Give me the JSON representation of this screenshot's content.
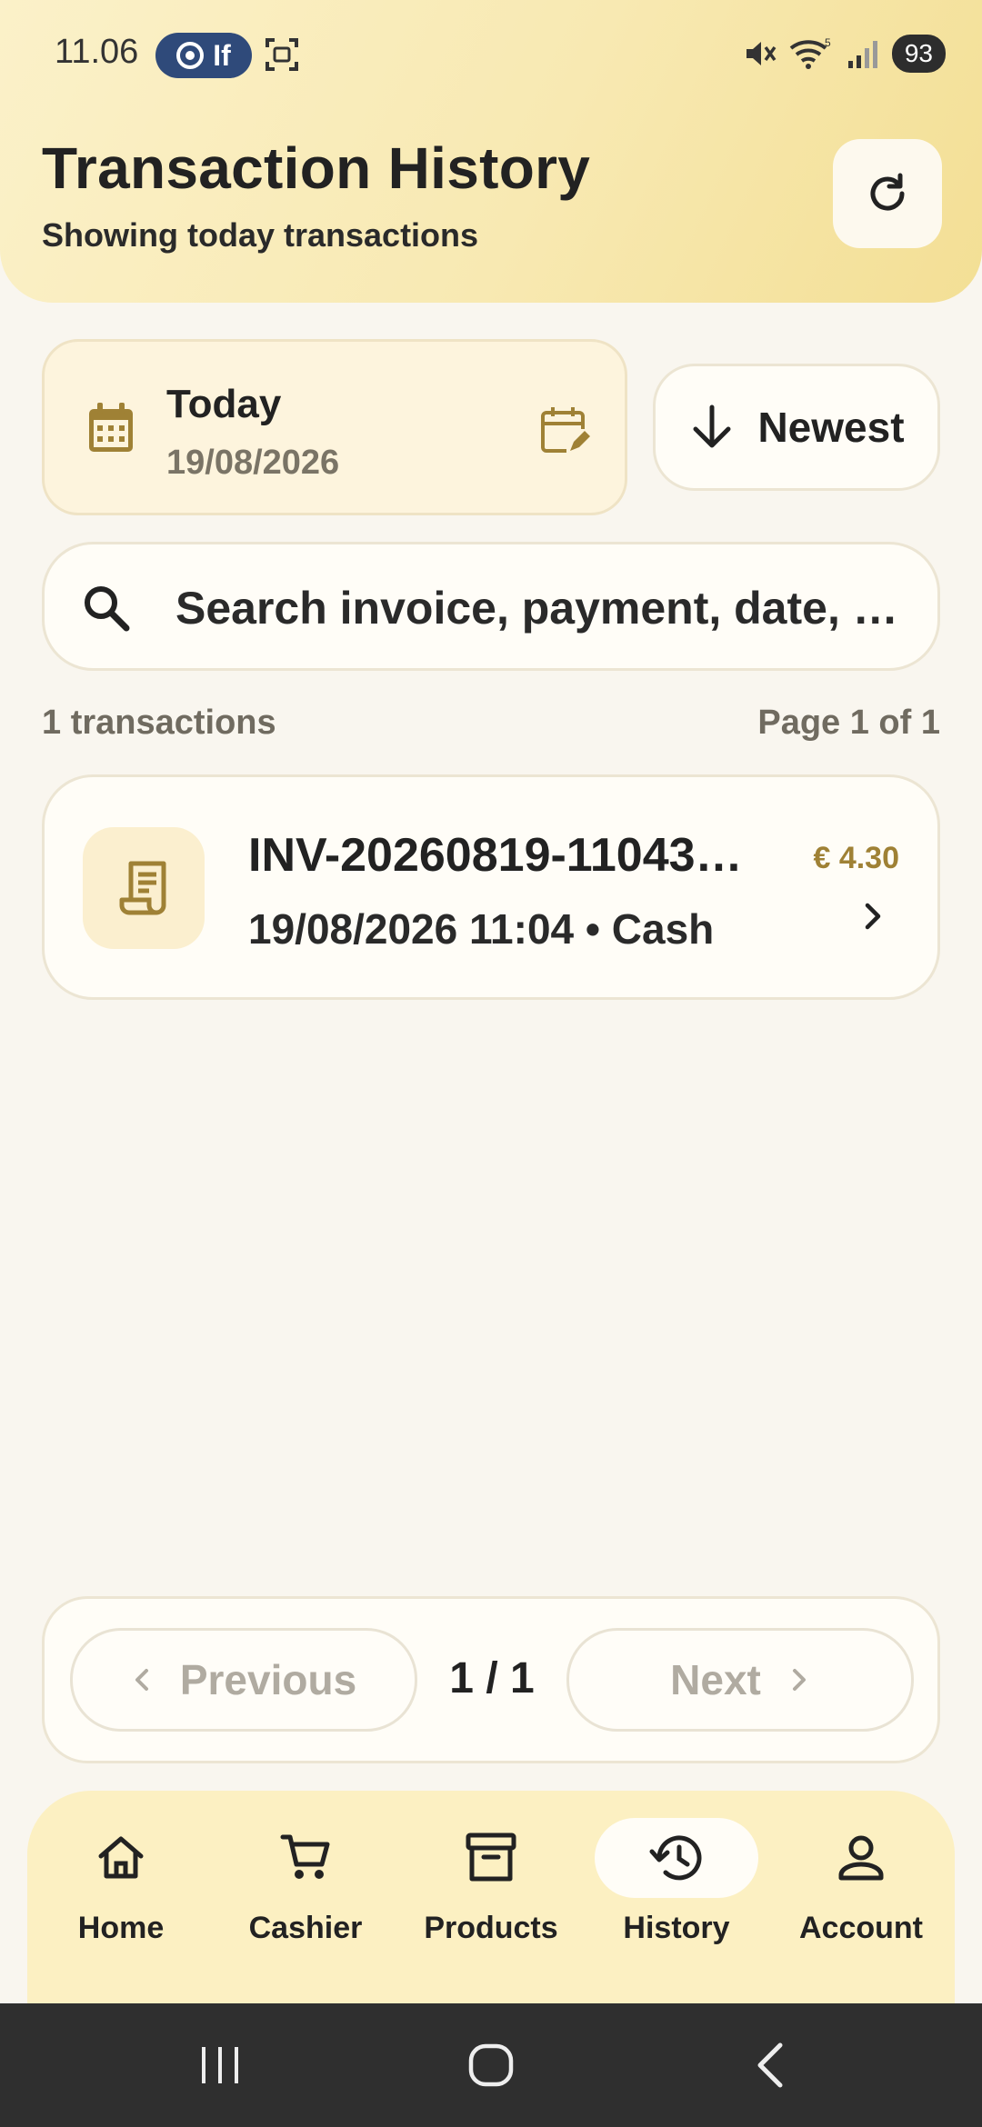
{
  "status_bar": {
    "time": "11.06",
    "pill_text": "If",
    "battery": "93",
    "wifi_badge": "5"
  },
  "header": {
    "title": "Transaction History",
    "subtitle": "Showing today transactions",
    "refresh_icon": "refresh-icon"
  },
  "date_filter": {
    "label": "Today",
    "value": "19/08/2026",
    "icon": "calendar-icon",
    "edit_icon": "calendar-edit-icon"
  },
  "sort": {
    "label": "Newest",
    "icon": "arrow-down-icon"
  },
  "search": {
    "placeholder": "Search invoice, payment, date, …",
    "value": ""
  },
  "results": {
    "count_text": "1 transactions",
    "page_text": "Page 1 of 1"
  },
  "transactions": [
    {
      "invoice": "INV-20260819-11043…",
      "meta": "19/08/2026 11:04 • Cash",
      "amount": "€ 4.30",
      "icon": "receipt-icon"
    }
  ],
  "pagination": {
    "previous_label": "Previous",
    "next_label": "Next",
    "page_indicator": "1 / 1"
  },
  "nav": {
    "items": [
      {
        "label": "Home",
        "icon": "home-icon",
        "active": false
      },
      {
        "label": "Cashier",
        "icon": "cart-icon",
        "active": false
      },
      {
        "label": "Products",
        "icon": "archive-box-icon",
        "active": false
      },
      {
        "label": "History",
        "icon": "history-icon",
        "active": true
      },
      {
        "label": "Account",
        "icon": "person-icon",
        "active": false
      }
    ]
  },
  "colors": {
    "accent": "#9f8135",
    "header_bg": "#f8e9b2",
    "nav_bg": "#fcf0c2",
    "page_bg": "#f9f6ef"
  }
}
